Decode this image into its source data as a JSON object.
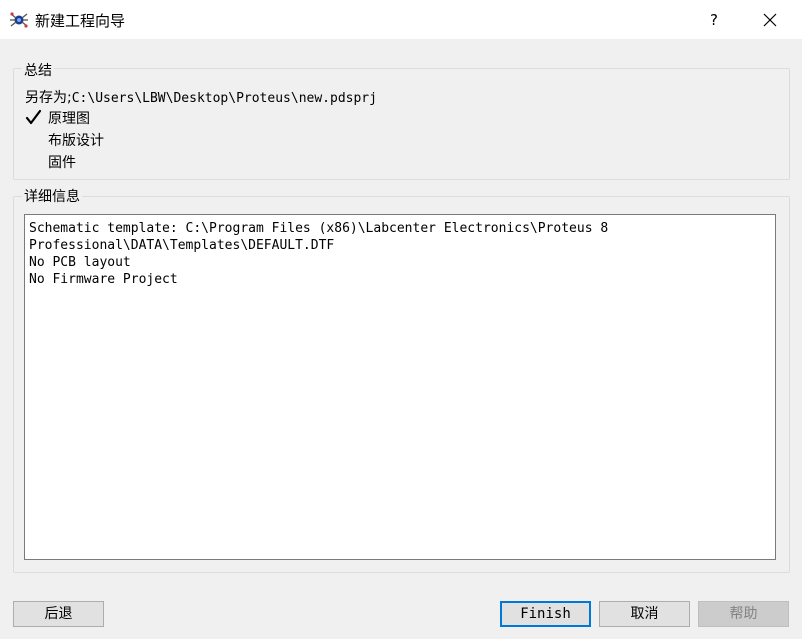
{
  "window": {
    "title": "新建工程向导",
    "help_label": "?",
    "icons": {
      "app": "proteus-app-icon",
      "close": "close-icon"
    }
  },
  "summary": {
    "legend": "总结",
    "save_as_label": "另存为;",
    "save_as_path": "C:\\Users\\LBW\\Desktop\\Proteus\\new.pdsprj",
    "options": [
      {
        "label": "原理图",
        "checked": true
      },
      {
        "label": "布版设计",
        "checked": false
      },
      {
        "label": "固件",
        "checked": false
      }
    ]
  },
  "details": {
    "legend": "详细信息",
    "lines": [
      "Schematic template: C:\\Program Files (x86)\\Labcenter Electronics\\Proteus 8",
      "Professional\\DATA\\Templates\\DEFAULT.DTF",
      "No PCB layout",
      "No Firmware Project"
    ]
  },
  "buttons": {
    "back": "后退",
    "finish": "Finish",
    "cancel": "取消",
    "help": "帮助"
  },
  "colors": {
    "focus_border": "#0078d7",
    "background": "#f0f0f0"
  }
}
